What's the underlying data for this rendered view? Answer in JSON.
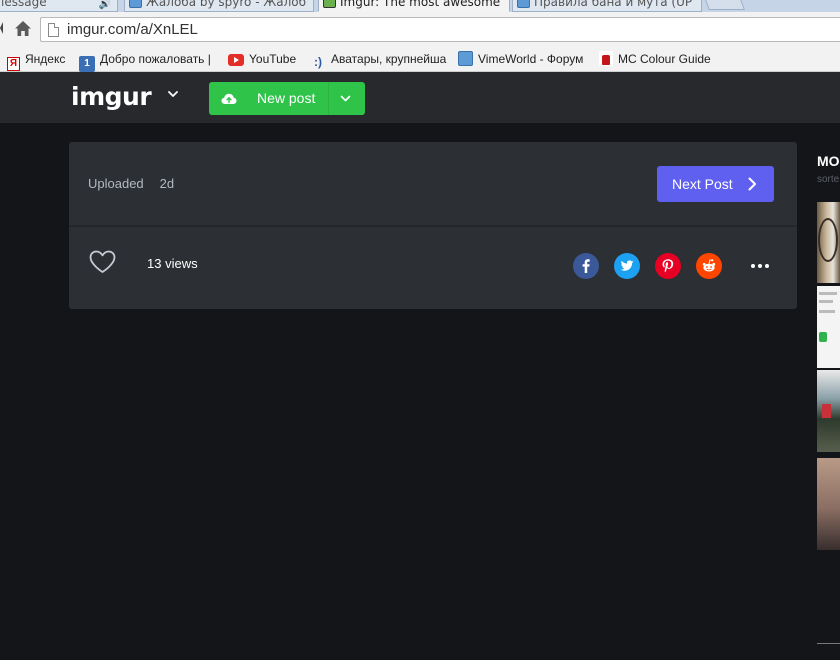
{
  "browser": {
    "tabs": [
      {
        "title": "lessage",
        "active": false,
        "icon": "speaker-icon"
      },
      {
        "title": "Жалоба by spyro - Жалоб",
        "active": false,
        "icon": "vimeworld-icon"
      },
      {
        "title": "Imgur: The most awesome",
        "active": true,
        "icon": "imgur-icon"
      },
      {
        "title": "Правила бана и мута (UP",
        "active": false,
        "icon": "vimeworld-icon"
      }
    ],
    "url": "imgur.com/a/XnLEL",
    "bookmarks": [
      {
        "label": "Яндекс",
        "icon": "yandex-icon"
      },
      {
        "label": "Добро пожаловать |",
        "icon": "one-icon"
      },
      {
        "label": "YouTube",
        "icon": "youtube-icon"
      },
      {
        "label": "Аватары, крупнейша",
        "icon": "smile-icon"
      },
      {
        "label": "VimeWorld - Форум",
        "icon": "vimeworld-icon"
      },
      {
        "label": "MC Colour Guide",
        "icon": "mc-icon"
      }
    ]
  },
  "header": {
    "logo": "imgur",
    "new_post_label": "New post"
  },
  "post": {
    "uploaded_label": "Uploaded",
    "uploaded_time": "2d",
    "next_post_label": "Next Post",
    "views_label": "13 views",
    "share_icons": [
      "facebook-icon",
      "twitter-icon",
      "pinterest-icon",
      "reddit-icon"
    ]
  },
  "sidebar": {
    "title": "MO",
    "subtitle": "sorte"
  },
  "colors": {
    "page_bg": "#141518",
    "header_bg": "#27292d",
    "card_bg": "#2c2f34",
    "new_post_green": "#30c34a",
    "next_post_blue": "#6060f0",
    "facebook": "#3b5998",
    "twitter": "#1da1f2",
    "pinterest": "#e60023",
    "reddit": "#ff4500"
  }
}
